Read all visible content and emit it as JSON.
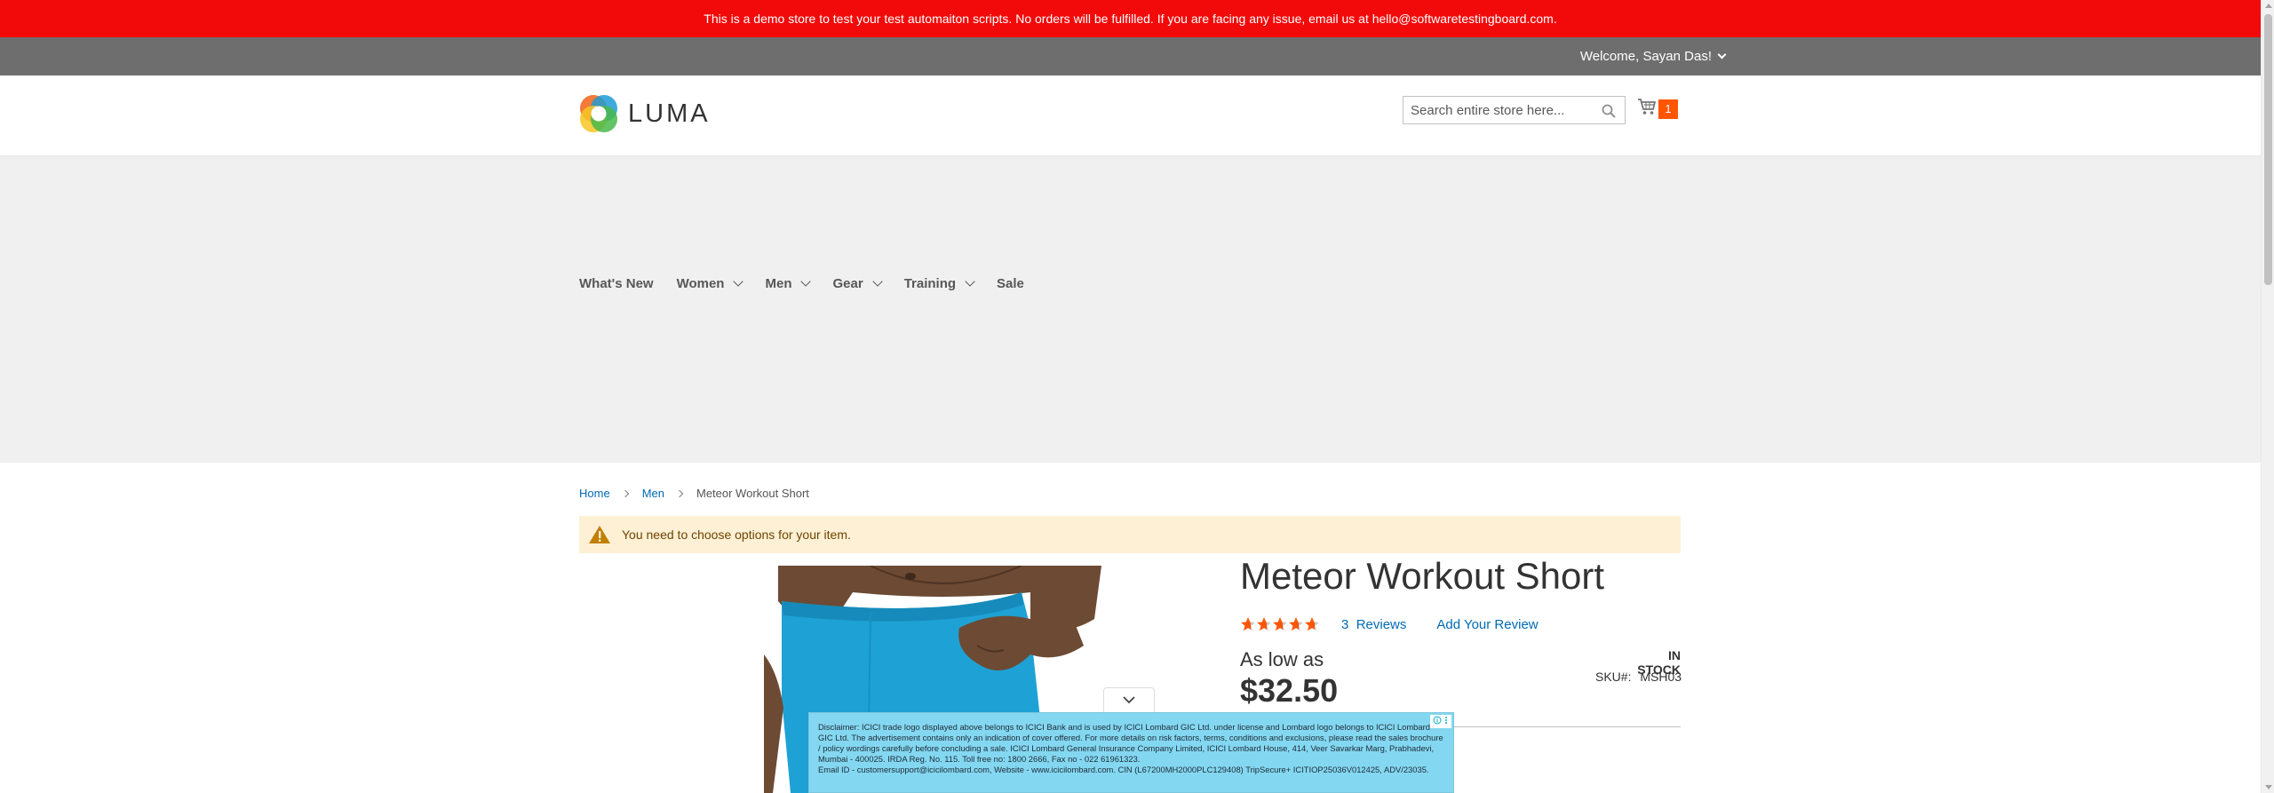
{
  "demo_notice": "This is a demo store to test your test automaiton scripts. No orders will be fulfilled. If you are facing any issue, email us at hello@softwaretestingboard.com.",
  "header": {
    "welcome": "Welcome, Sayan Das!",
    "logo_text": "LUMA",
    "search_placeholder": "Search entire store here...",
    "cart_count": "1"
  },
  "nav": {
    "items": [
      {
        "label": "What's New",
        "has_dropdown": false
      },
      {
        "label": "Women",
        "has_dropdown": true
      },
      {
        "label": "Men",
        "has_dropdown": true
      },
      {
        "label": "Gear",
        "has_dropdown": true
      },
      {
        "label": "Training",
        "has_dropdown": true
      },
      {
        "label": "Sale",
        "has_dropdown": false
      }
    ]
  },
  "breadcrumb": {
    "home": "Home",
    "men": "Men",
    "current": "Meteor Workout Short"
  },
  "message": "You need to choose options for your item.",
  "product": {
    "title": "Meteor Workout Short",
    "rating_fraction": 0.7,
    "reviews_count": "3",
    "reviews_label": "Reviews",
    "add_review": "Add Your Review",
    "as_low_as": "As low as",
    "price": "$32.50",
    "stock": "IN STOCK",
    "sku_label": "SKU#:",
    "sku": "MSH03"
  },
  "ad": {
    "line1": "Disclaimer: ICICI trade logo displayed above belongs to ICICI Bank and is used by ICICI Lombard GIC Ltd. under license and Lombard logo belongs to ICICI Lombard GIC Ltd. The advertisement contains only an indication of cover offered. For more details on risk factors, terms, conditions and exclusions, please read the sales brochure / policy wordings carefully before concluding a sale. ICICI Lombard General Insurance Company Limited, ICICI Lombard House, 414, Veer Savarkar Marg, Prabhadevi, Mumbai - 400025. IRDA Reg. No. 115. Toll free no: 1800 2666, Fax no - 022 61961323.",
    "line2": "Email ID - customersupport@icicilombard.com, Website - www.icicilombard.com. CIN (L67200MH2000PLC129408) TripSecure+ ICITIOP25036V012425, ADV/23035."
  },
  "colors": {
    "demo_bar": "#f20a0a",
    "header_panel": "#6e6e6e",
    "link": "#006bb4",
    "cart_badge": "#ff5501",
    "star": "#ff5501",
    "message_bg": "#fdf0d5",
    "ad_bg": "#84d7f0"
  }
}
